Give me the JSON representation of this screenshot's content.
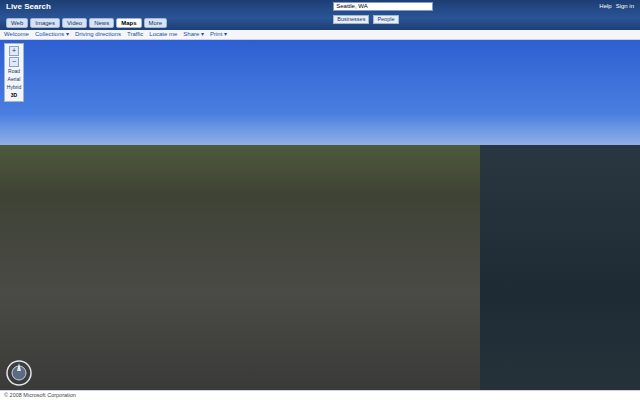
{
  "brand": "Live Search",
  "tabs": [
    {
      "label": "Web",
      "selected": false
    },
    {
      "label": "Images",
      "selected": false
    },
    {
      "label": "Video",
      "selected": false
    },
    {
      "label": "News",
      "selected": false
    },
    {
      "label": "Maps",
      "selected": true
    },
    {
      "label": "More",
      "selected": false
    }
  ],
  "search": {
    "value": "Seattle, WA",
    "buttons": [
      "Businesses",
      "People"
    ]
  },
  "header_links": [
    "Help",
    "Sign in"
  ],
  "toolbar": [
    "Welcome",
    "Collections ▾",
    "Driving directions",
    "Traffic",
    "Locate me",
    "Share ▾",
    "Print ▾"
  ],
  "map_controls": {
    "zoom_in": "+",
    "zoom_out": "−",
    "styles": [
      {
        "label": "Road",
        "selected": false
      },
      {
        "label": "Aerial",
        "selected": false
      },
      {
        "label": "Hybrid",
        "selected": false
      },
      {
        "label": "3D",
        "selected": true
      }
    ]
  },
  "copyright": "© 2008 Microsoft Corporation"
}
